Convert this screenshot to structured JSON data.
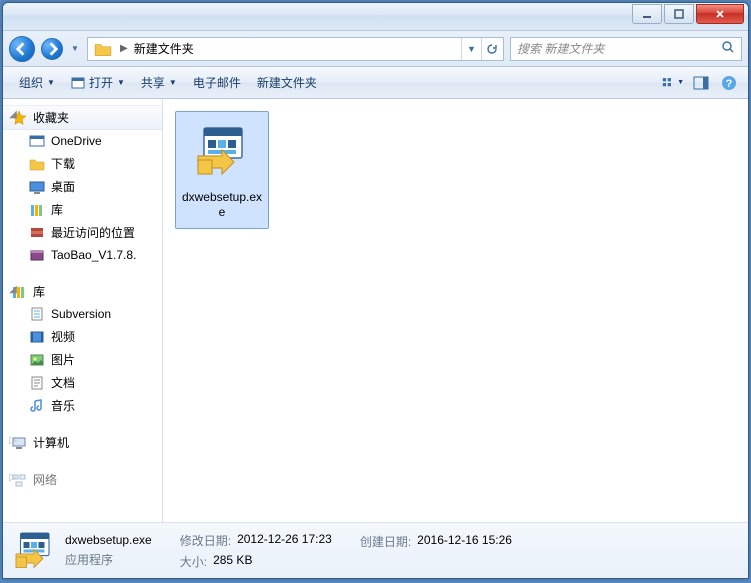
{
  "breadcrumb": {
    "folder": "新建文件夹"
  },
  "search": {
    "placeholder": "搜索 新建文件夹"
  },
  "toolbar": {
    "organize": "组织",
    "open": "打开",
    "share": "共享",
    "email": "电子邮件",
    "newfolder": "新建文件夹"
  },
  "sidebar": {
    "favorites": "收藏夹",
    "fav_items": [
      "OneDrive",
      "下载",
      "桌面",
      "库",
      "最近访问的位置",
      "TaoBao_V1.7.8."
    ],
    "libraries": "库",
    "lib_items": [
      "Subversion",
      "视频",
      "图片",
      "文档",
      "音乐"
    ],
    "computer": "计算机",
    "network": "网络"
  },
  "file": {
    "name": "dxwebsetup.exe"
  },
  "details": {
    "name": "dxwebsetup.exe",
    "type": "应用程序",
    "mod_label": "修改日期:",
    "mod_value": "2012-12-26 17:23",
    "size_label": "大小:",
    "size_value": "285 KB",
    "created_label": "创建日期:",
    "created_value": "2016-12-16 15:26"
  }
}
